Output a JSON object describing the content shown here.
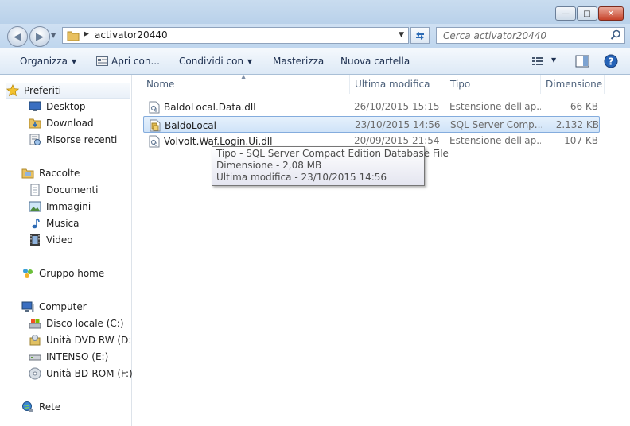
{
  "address": {
    "path": "activator20440"
  },
  "search": {
    "placeholder": "Cerca activator20440"
  },
  "toolbar": {
    "organize": "Organizza",
    "open_with": "Apri con...",
    "share_with": "Condividi con",
    "burn": "Masterizza",
    "new_folder": "Nuova cartella"
  },
  "sidebar": {
    "favorites": {
      "label": "Preferiti",
      "items": [
        "Desktop",
        "Download",
        "Risorse recenti"
      ]
    },
    "libraries": {
      "label": "Raccolte",
      "items": [
        "Documenti",
        "Immagini",
        "Musica",
        "Video"
      ]
    },
    "homegroup": {
      "label": "Gruppo home"
    },
    "computer": {
      "label": "Computer",
      "items": [
        "Disco locale (C:)",
        "Unità DVD RW (D:) C",
        "INTENSO (E:)",
        "Unità BD-ROM (F:) P"
      ]
    },
    "network": {
      "label": "Rete"
    }
  },
  "columns": {
    "name": "Nome",
    "modified": "Ultima modifica",
    "type": "Tipo",
    "size": "Dimensione"
  },
  "files": [
    {
      "name": "BaldoLocal.Data.dll",
      "modified": "26/10/2015 15:15",
      "type": "Estensione dell'ap...",
      "size": "66 KB"
    },
    {
      "name": "BaldoLocal",
      "modified": "23/10/2015 14:56",
      "type": "SQL Server Comp...",
      "size": "2.132 KB"
    },
    {
      "name": "VolvoIt.Waf.Login.Ui.dll",
      "modified": "20/09/2015 21:54",
      "type": "Estensione dell'ap...",
      "size": "107 KB"
    }
  ],
  "tooltip": {
    "type": "Tipo - SQL Server Compact Edition Database File",
    "size": "Dimensione - 2,08 MB",
    "modified": "Ultima modifica - 23/10/2015 14:56"
  }
}
